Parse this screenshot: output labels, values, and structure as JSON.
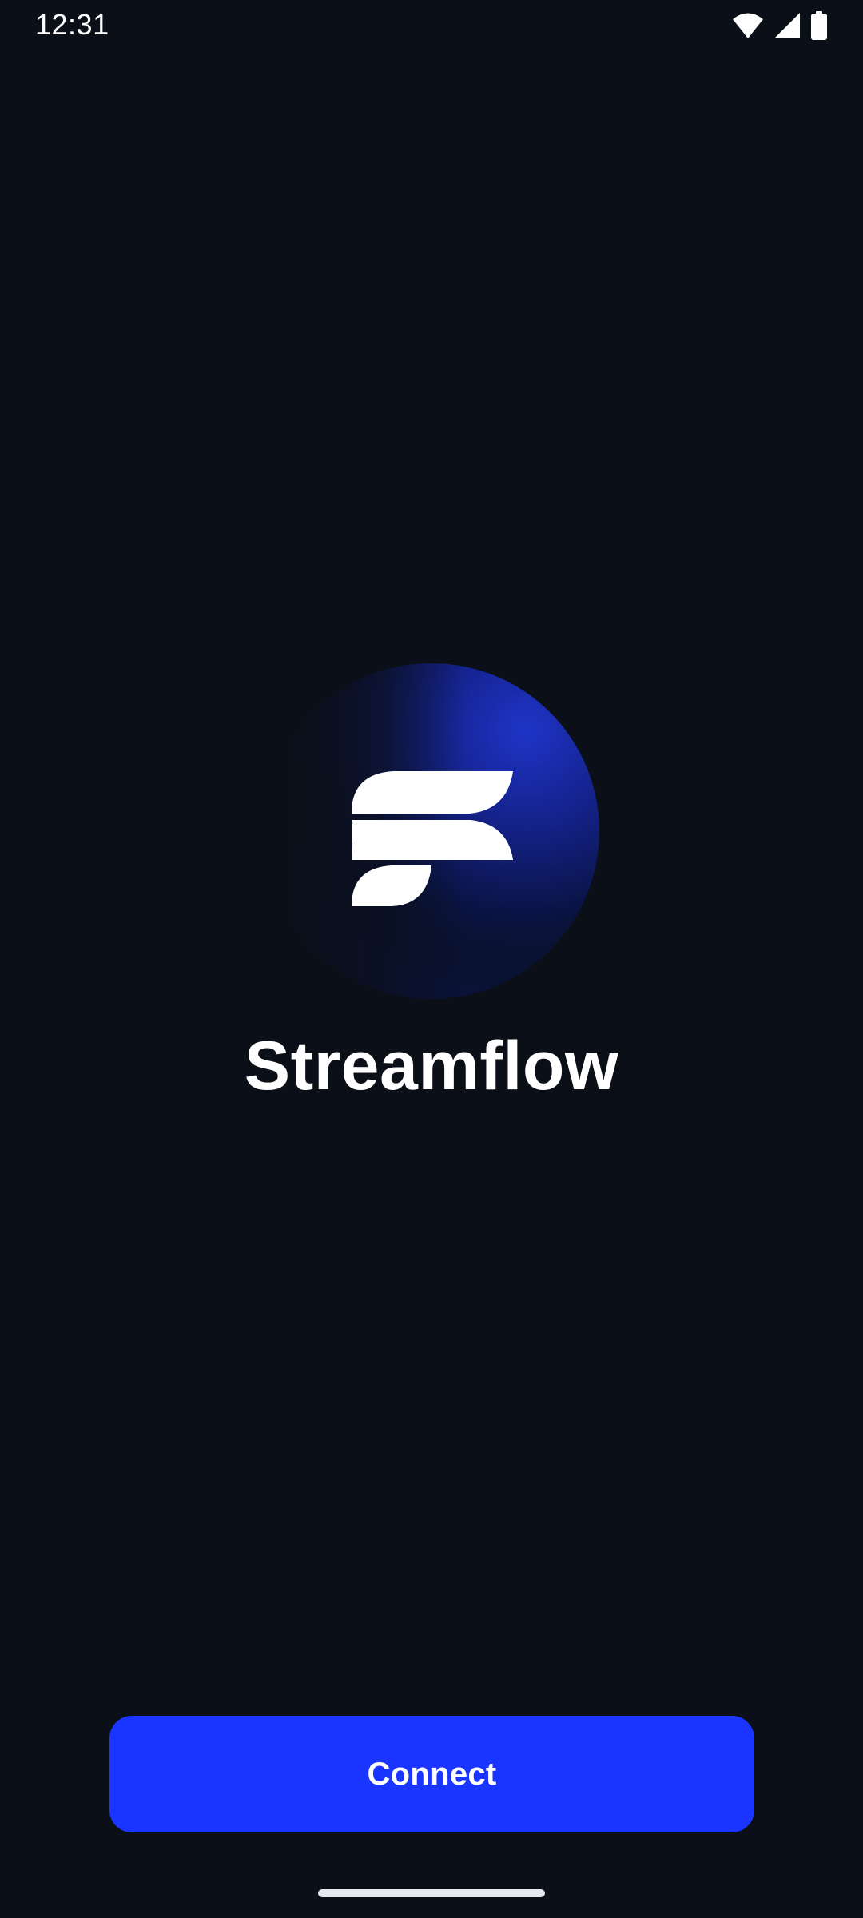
{
  "status_bar": {
    "time": "12:31",
    "icons": [
      "wifi-icon",
      "signal-icon",
      "battery-icon"
    ]
  },
  "brand": {
    "logo_icon": "streamflow-logo-icon",
    "app_name": "Streamflow"
  },
  "actions": {
    "connect_label": "Connect"
  },
  "colors": {
    "background": "#0b0f17",
    "accent": "#1a35ff",
    "logo_glow": "#1f34c8",
    "text": "#ffffff"
  }
}
